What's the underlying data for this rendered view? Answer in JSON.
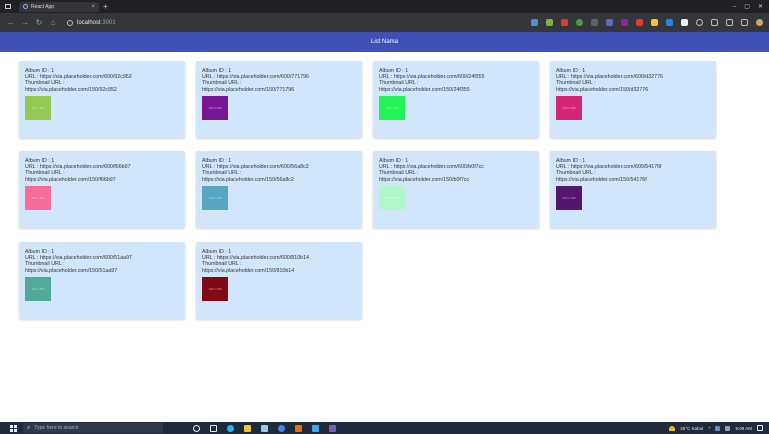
{
  "browser": {
    "tab_title": "React App",
    "tab_close": "×",
    "new_tab": "+",
    "window_controls": {
      "minimize": "–",
      "maximize": "▢",
      "close": "✕"
    },
    "nav": {
      "back": "←",
      "forward": "→",
      "reload": "↻",
      "home": "⌂"
    },
    "url_host": "localhost",
    "url_port": ":3001"
  },
  "header": {
    "title": "List Nama"
  },
  "cards": [
    {
      "album": "Album ID : 1",
      "url": "URL : https://via.placeholder.com/600/92c952",
      "thumb_label": "Thumbnail URL :",
      "thumb_url": "https://via.placeholder.com/150/92c952",
      "color": "#92c952",
      "thumb_text": "150 x 150"
    },
    {
      "album": "Album ID : 1",
      "url": "URL : https://via.placeholder.com/600/771796",
      "thumb_label": "Thumbnail URL :",
      "thumb_url": "https://via.placeholder.com/150/771796",
      "color": "#771796",
      "thumb_text": "150 x 150"
    },
    {
      "album": "Album ID : 1",
      "url": "URL : https://via.placeholder.com/600/24f355",
      "thumb_label": "Thumbnail URL :",
      "thumb_url": "https://via.placeholder.com/150/24f355",
      "color": "#24f355",
      "thumb_text": "150 x 150"
    },
    {
      "album": "Album ID : 1",
      "url": "URL : https://via.placeholder.com/600/d32776",
      "thumb_label": "Thumbnail URL :",
      "thumb_url": "https://via.placeholder.com/150/d32776",
      "color": "#d32776",
      "thumb_text": "150 x 150"
    },
    {
      "album": "Album ID : 1",
      "url": "URL : https://via.placeholder.com/600/f66b97",
      "thumb_label": "Thumbnail URL :",
      "thumb_url": "https://via.placeholder.com/150/f66b97",
      "color": "#f66b97",
      "thumb_text": "150 x 150"
    },
    {
      "album": "Album ID : 1",
      "url": "URL : https://via.placeholder.com/600/56a8c2",
      "thumb_label": "Thumbnail URL :",
      "thumb_url": "https://via.placeholder.com/150/56a8c2",
      "color": "#56a8c2",
      "thumb_text": "150 x 150"
    },
    {
      "album": "Album ID : 1",
      "url": "URL : https://via.placeholder.com/600/b0f7cc",
      "thumb_label": "Thumbnail URL :",
      "thumb_url": "https://via.placeholder.com/150/b0f7cc",
      "color": "#b0f7cc",
      "thumb_text": "150 x 150"
    },
    {
      "album": "Album ID : 1",
      "url": "URL : https://via.placeholder.com/600/54176f",
      "thumb_label": "Thumbnail URL :",
      "thumb_url": "https://via.placeholder.com/150/54176f",
      "color": "#54176f",
      "thumb_text": "150 x 150"
    },
    {
      "album": "Album ID : 1",
      "url": "URL : https://via.placeholder.com/600/51aa97",
      "thumb_label": "Thumbnail URL :",
      "thumb_url": "https://via.placeholder.com/150/51aa97",
      "color": "#51aa97",
      "thumb_text": "150 x 150"
    },
    {
      "album": "Album ID : 1",
      "url": "URL : https://via.placeholder.com/600/810b14",
      "thumb_label": "Thumbnail URL :",
      "thumb_url": "https://via.placeholder.com/150/810b14",
      "color": "#810b14",
      "thumb_text": "150 x 150"
    }
  ],
  "taskbar": {
    "search_placeholder": "Type here to search",
    "search_icon": "⌕",
    "weather": "25°C Kabut",
    "tray_arrow": "^",
    "time": "5:09 AM",
    "date": ""
  },
  "colors": {
    "header": "#3f51b5",
    "card_bg": "#d1e6fa",
    "tabbar": "#202124",
    "addrbar": "#35363a",
    "taskbar": "#1f2a3a"
  }
}
